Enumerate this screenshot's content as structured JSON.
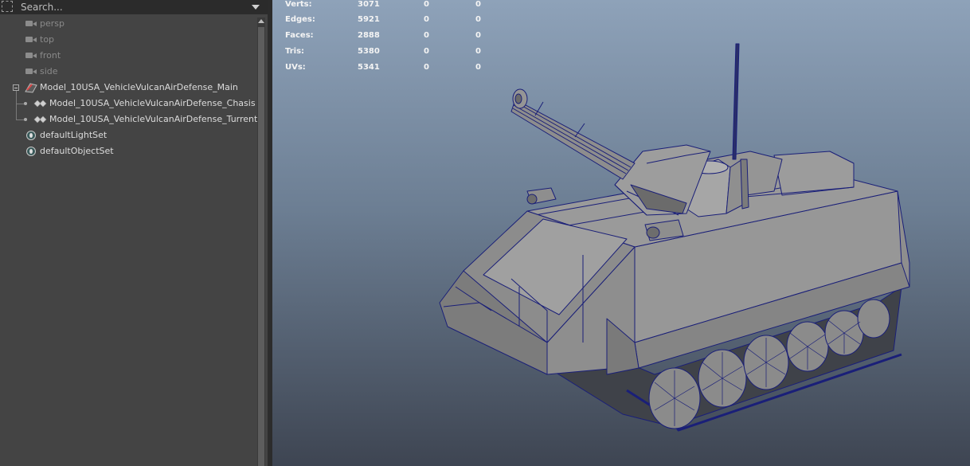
{
  "outliner": {
    "search_placeholder": "Search...",
    "cameras": [
      "persp",
      "top",
      "front",
      "side"
    ],
    "main_group": "Model_10USA_VehicleVulcanAirDefense_Main",
    "children": [
      "Model_10USA_VehicleVulcanAirDefense_Chasis",
      "Model_10USA_VehicleVulcanAirDefense_Turrent"
    ],
    "sets": [
      "defaultLightSet",
      "defaultObjectSet"
    ]
  },
  "hud": {
    "rows": [
      {
        "label": "Verts:",
        "v1": "3071",
        "v2": "0",
        "v3": "0"
      },
      {
        "label": "Edges:",
        "v1": "5921",
        "v2": "0",
        "v3": "0"
      },
      {
        "label": "Faces:",
        "v1": "2888",
        "v2": "0",
        "v3": "0"
      },
      {
        "label": "Tris:",
        "v1": "5380",
        "v2": "0",
        "v3": "0"
      },
      {
        "label": "UVs:",
        "v1": "5341",
        "v2": "0",
        "v3": "0"
      }
    ]
  },
  "colors": {
    "outliner_bg": "#444444",
    "wire": "#1a1f78",
    "mesh_fill": "#8a8a8a"
  },
  "icons": {
    "camera": "camera-icon",
    "transform": "transform-icon",
    "mesh": "mesh-icon",
    "set": "set-icon",
    "filter": "filter-icon",
    "dropdown": "chevron-down-icon"
  }
}
